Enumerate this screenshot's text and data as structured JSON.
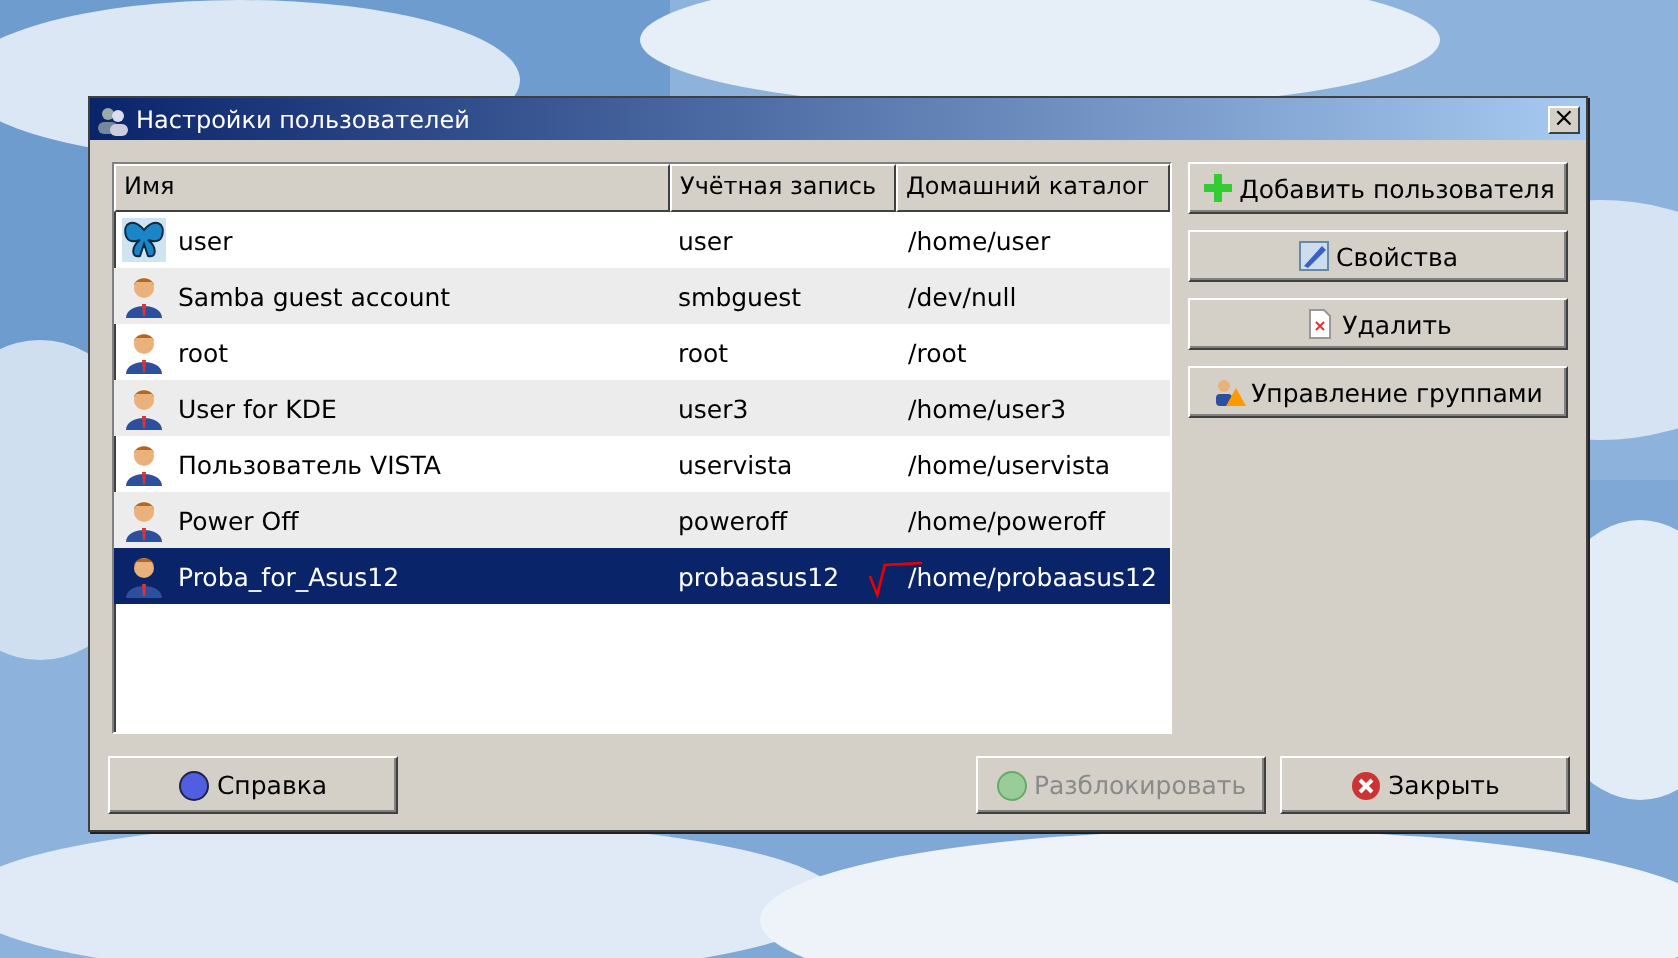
{
  "window": {
    "title": "Настройки пользователей",
    "close": "×"
  },
  "table": {
    "columns": [
      "Имя",
      "Учётная запись",
      "Домашний каталог"
    ],
    "rows": [
      {
        "kind": "butterfly",
        "name": "user",
        "account": "user",
        "home": "/home/user",
        "selected": false
      },
      {
        "kind": "person",
        "name": "Samba guest account",
        "account": "smbguest",
        "home": "/dev/null",
        "selected": false
      },
      {
        "kind": "person",
        "name": "root",
        "account": "root",
        "home": "/root",
        "selected": false
      },
      {
        "kind": "person",
        "name": "User for KDE",
        "account": "user3",
        "home": "/home/user3",
        "selected": false
      },
      {
        "kind": "person",
        "name": "Пользователь VISTA",
        "account": "uservista",
        "home": "/home/uservista",
        "selected": false
      },
      {
        "kind": "person",
        "name": "Power Off",
        "account": "poweroff",
        "home": "/home/poweroff",
        "selected": false
      },
      {
        "kind": "person",
        "name": "Proba_for_Asus12",
        "account": "probaasus12",
        "home": "/home/probaasus12",
        "selected": true
      }
    ]
  },
  "side_buttons": [
    {
      "kind": "add",
      "label": "Добавить пользователя",
      "disabled": false
    },
    {
      "kind": "properties",
      "label": "Свойства",
      "disabled": false
    },
    {
      "kind": "delete",
      "label": "Удалить",
      "disabled": false
    },
    {
      "kind": "groups",
      "label": "Управление группами",
      "disabled": false
    }
  ],
  "bottom_buttons": [
    {
      "kind": "help",
      "label": "Справка",
      "disabled": false
    },
    {
      "kind": "unlock",
      "label": "Разблокировать",
      "disabled": true
    },
    {
      "kind": "close",
      "label": "Закрыть",
      "disabled": false
    }
  ]
}
